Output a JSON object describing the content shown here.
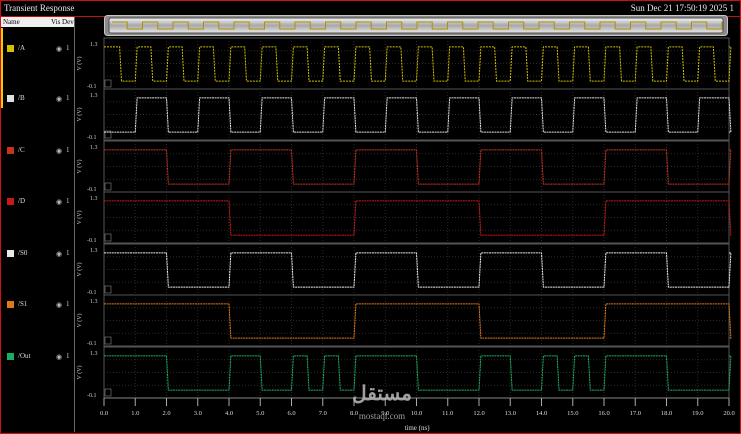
{
  "window": {
    "title": "Transient Response",
    "timestamp": "Sun Dec 21 17:50:19 2025",
    "page_num": "1"
  },
  "sidebar": {
    "header_name": "Name",
    "header_vis": "Vis Dev",
    "items": [
      {
        "name": "/A",
        "color": "#d4c000",
        "eye_icon": "eye-icon",
        "value": "1"
      },
      {
        "name": "/B",
        "color": "#e0e0e0",
        "eye_icon": "eye-icon",
        "value": "1"
      },
      {
        "name": "/C",
        "color": "#c83020",
        "eye_icon": "eye-icon",
        "value": "1"
      },
      {
        "name": "/D",
        "color": "#c81818",
        "eye_icon": "eye-icon",
        "value": "1"
      },
      {
        "name": "/S0",
        "color": "#e8e8e8",
        "eye_icon": "eye-icon",
        "value": "1"
      },
      {
        "name": "/S1",
        "color": "#e07818",
        "eye_icon": "eye-icon",
        "value": "1"
      },
      {
        "name": "/Out",
        "color": "#18b060",
        "eye_icon": "eye-icon",
        "value": "1"
      }
    ]
  },
  "plots": {
    "y_label": "V (V)",
    "y_top_label": "1.3",
    "y_bottom_label": "-0.1",
    "x_label": "time (ns)",
    "x_ticks": [
      "0.0",
      "1.0",
      "2.0",
      "3.0",
      "4.0",
      "5.0",
      "6.0",
      "7.0",
      "8.0",
      "9.0",
      "10.0",
      "11.0",
      "12.0",
      "13.0",
      "14.0",
      "15.0",
      "16.0",
      "17.0",
      "18.0",
      "19.0",
      "20.0"
    ],
    "x_range": [
      0,
      20
    ],
    "y_range": [
      -0.1,
      1.3
    ]
  },
  "watermark": {
    "arabic": "مستقل",
    "latin": "mostaql.com"
  },
  "chart_data": {
    "type": "line",
    "title": "Transient Response",
    "xlabel": "time (ns)",
    "ylabel": "V (V)",
    "xlim": [
      0,
      20
    ],
    "ylim": [
      -0.1,
      1.3
    ],
    "series": [
      {
        "name": "/A",
        "color": "#d4c000",
        "x": [
          0,
          0.5,
          1.0,
          1.5,
          2.0,
          2.5,
          3.0,
          3.5,
          4.0,
          4.5,
          5.0,
          5.5,
          6.0,
          6.5,
          7.0,
          7.5,
          8.0,
          8.5,
          9.0,
          9.5,
          10.0,
          10.5,
          11.0,
          11.5,
          12.0,
          12.5,
          13.0,
          13.5,
          14.0,
          14.5,
          15.0,
          15.5,
          16.0,
          16.5,
          17.0,
          17.5,
          18.0,
          18.5,
          19.0,
          19.5,
          20.0
        ],
        "y": [
          1.2,
          0,
          1.2,
          0,
          1.2,
          0,
          1.2,
          0,
          1.2,
          0,
          1.2,
          0,
          1.2,
          0,
          1.2,
          0,
          1.2,
          0,
          1.2,
          0,
          1.2,
          0,
          1.2,
          0,
          1.2,
          0,
          1.2,
          0,
          1.2,
          0,
          1.2,
          0,
          1.2,
          0,
          1.2,
          0,
          1.2,
          0,
          1.2,
          0,
          1.2
        ]
      },
      {
        "name": "/B",
        "color": "#e0e0e0",
        "x": [
          0,
          1,
          2,
          3,
          4,
          5,
          6,
          7,
          8,
          9,
          10,
          11,
          12,
          13,
          14,
          15,
          16,
          17,
          18,
          19,
          20
        ],
        "y": [
          0,
          1.2,
          0,
          1.2,
          0,
          1.2,
          0,
          1.2,
          0,
          1.2,
          0,
          1.2,
          0,
          1.2,
          0,
          1.2,
          0,
          1.2,
          0,
          1.2,
          0
        ]
      },
      {
        "name": "/C",
        "color": "#c83020",
        "x": [
          0,
          2,
          4,
          6,
          8,
          10,
          12,
          14,
          16,
          18,
          20
        ],
        "y": [
          1.2,
          0,
          1.2,
          0,
          1.2,
          0,
          1.2,
          0,
          1.2,
          0,
          1.2
        ]
      },
      {
        "name": "/D",
        "color": "#c81818",
        "x": [
          0,
          4,
          8,
          12,
          16,
          20
        ],
        "y": [
          1.2,
          0,
          1.2,
          0,
          1.2,
          0
        ]
      },
      {
        "name": "/S0",
        "color": "#e8e8e8",
        "x": [
          0,
          2,
          4,
          6,
          8,
          10,
          12,
          14,
          16,
          18,
          20
        ],
        "y": [
          1.2,
          0,
          1.2,
          0,
          1.2,
          0,
          1.2,
          0,
          1.2,
          0,
          1.2
        ]
      },
      {
        "name": "/S1",
        "color": "#e07818",
        "x": [
          0,
          4,
          8,
          12,
          16,
          20
        ],
        "y": [
          1.2,
          0,
          1.2,
          0,
          1.2,
          0
        ]
      },
      {
        "name": "/Out",
        "color": "#18b060",
        "x": [
          0,
          2,
          4,
          5,
          6,
          6.5,
          7,
          7.5,
          8,
          10,
          12,
          13,
          14,
          14.5,
          15,
          15.5,
          16,
          18,
          20
        ],
        "y": [
          1.2,
          0,
          1.2,
          0,
          1.2,
          0,
          1.2,
          0,
          1.2,
          0,
          1.2,
          0,
          1.2,
          0,
          1.2,
          0,
          1.2,
          0,
          1.2
        ]
      }
    ]
  }
}
